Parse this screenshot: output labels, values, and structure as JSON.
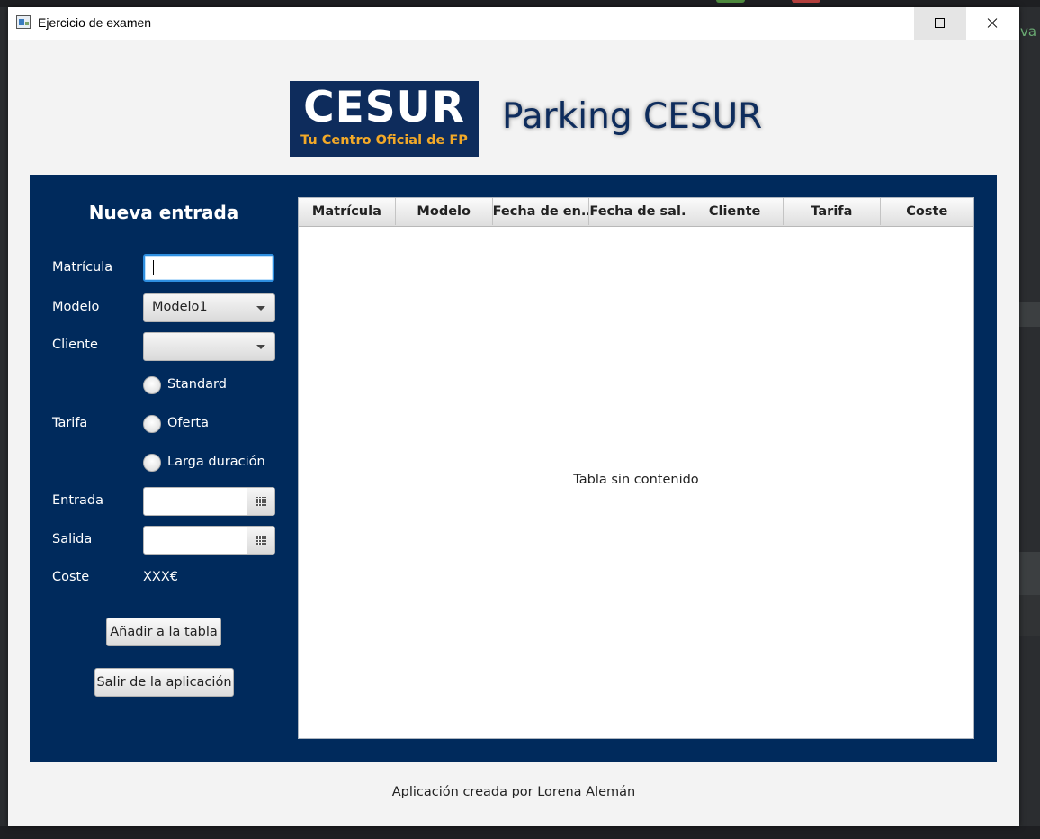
{
  "window": {
    "title": "Ejercicio de examen"
  },
  "header": {
    "logo_word": "CESUR",
    "logo_tagline": "Tu Centro Oficial de FP",
    "app_title": "Parking CESUR"
  },
  "form": {
    "title": "Nueva entrada",
    "labels": {
      "matricula": "Matrícula",
      "modelo": "Modelo",
      "cliente": "Cliente",
      "tarifa": "Tarifa",
      "entrada": "Entrada",
      "salida": "Salida",
      "coste": "Coste"
    },
    "matricula_value": "",
    "modelo_selected": "Modelo1",
    "cliente_selected": "",
    "tarifa_options": [
      "Standard",
      "Oferta",
      "Larga duración"
    ],
    "entrada_value": "",
    "salida_value": "",
    "coste_value": "XXX€",
    "add_button": "Añadir a la tabla",
    "exit_button": "Salir de la aplicación"
  },
  "table": {
    "columns": [
      "Matrícula",
      "Modelo",
      "Fecha de en...",
      "Fecha de sal...",
      "Cliente",
      "Tarifa",
      "Coste"
    ],
    "rows": [],
    "empty_message": "Tabla sin contenido"
  },
  "footer": {
    "credit": "Aplicación creada por Lorena Alemán"
  },
  "colors": {
    "panel_bg": "#002a5c",
    "logo_bg": "#0e2c5c",
    "logo_tagline": "#f2a928",
    "focus_border": "#2e8fe0"
  },
  "icons": [
    "app-icon",
    "minimize-icon",
    "maximize-icon",
    "close-icon",
    "chevron-down-icon",
    "calendar-icon"
  ]
}
